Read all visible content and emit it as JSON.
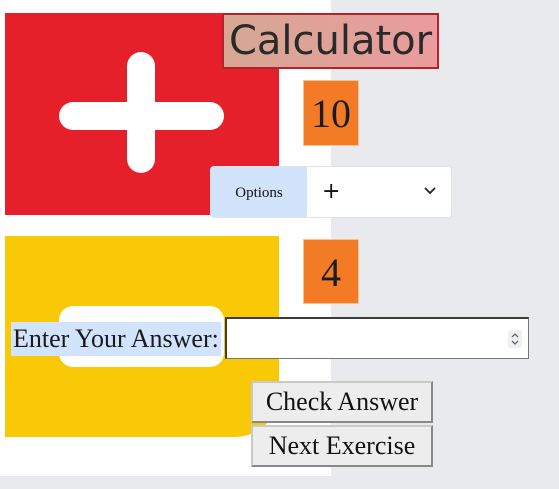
{
  "app": {
    "title": "Calculator"
  },
  "exercise": {
    "first_number": "10",
    "second_number": "4"
  },
  "operation": {
    "label": "Options",
    "selected": "+",
    "chevron_icon": "chevron-down-icon"
  },
  "answer": {
    "label": "Enter Your Answer:",
    "value": "",
    "spinner_icon": "number-spinner-icon"
  },
  "buttons": {
    "check": "Check Answer",
    "next": "Next Exercise"
  },
  "colors": {
    "plus_logo": "#e6202a",
    "minus_logo": "#f9c908",
    "number_box": "#f47b25",
    "label_highlight": "#d2e3fc",
    "title_border": "#b4232b"
  }
}
